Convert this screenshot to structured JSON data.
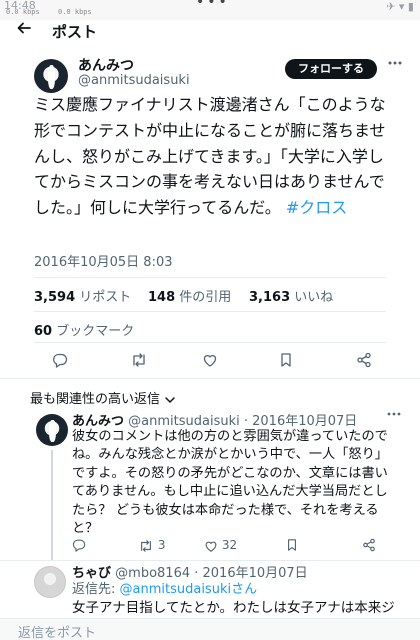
{
  "status_bar": {
    "time": "14:48",
    "net_left": "0.0 kbps",
    "net_right": "0.0 kbps",
    "dots": "•••",
    "right_icons": "✈ ▾ ▮"
  },
  "header": {
    "title": "ポスト"
  },
  "tweet": {
    "author_name": "あんみつ",
    "author_handle": "@anmitsudaisuki",
    "follow_label": "フォローする",
    "text": "ミス慶應ファイナリスト渡邊渚さん「このような形でコンテストが中止になることが腑に落ちませんし、怒りがこみ上げてきます。」「大学に入学してからミスコンの事を考えない日はありませんでした。」何しに大学行ってるんだ。",
    "hashtag": "#クロス",
    "timestamp": "2016年10月05日 8:03",
    "stats": {
      "reposts_count": "3,594",
      "reposts_label": "リポスト",
      "quotes_count": "148",
      "quotes_label": "件の引用",
      "likes_count": "3,163",
      "likes_label": "いいね",
      "bookmarks_count": "60",
      "bookmarks_label": "ブックマーク"
    }
  },
  "replies_sort": {
    "label": "最も関連性の高い返信"
  },
  "replies": [
    {
      "name": "あんみつ",
      "handle": "@anmitsudaisuki",
      "date": "· 2016年10月07日",
      "text": "彼女のコメントは他の方のと雰囲気が違っていたのでね。みんな残念とか涙がとかいう中で、一人「怒り」ですよ。その怒りの矛先がどこなのか、文章には書いてありません。もし中止に追い込んだ大学当局だとしたら？ どうも彼女は本命だった様で、それを考えると？",
      "retweets": "3",
      "likes": "32"
    },
    {
      "name": "ちゃび",
      "handle": "@mbo8164",
      "date": "· 2016年10月07日",
      "reply_to_prefix": "返信先: ",
      "reply_to_mention": "@anmitsudaisukiさん",
      "text": "女子アナ目指してたとか。わたしは女子アナは本来ジ"
    }
  ],
  "composer": {
    "placeholder": "返信をポスト"
  },
  "colors": {
    "accent": "#1d9bf0",
    "text": "#0f1419",
    "muted": "#536471"
  }
}
